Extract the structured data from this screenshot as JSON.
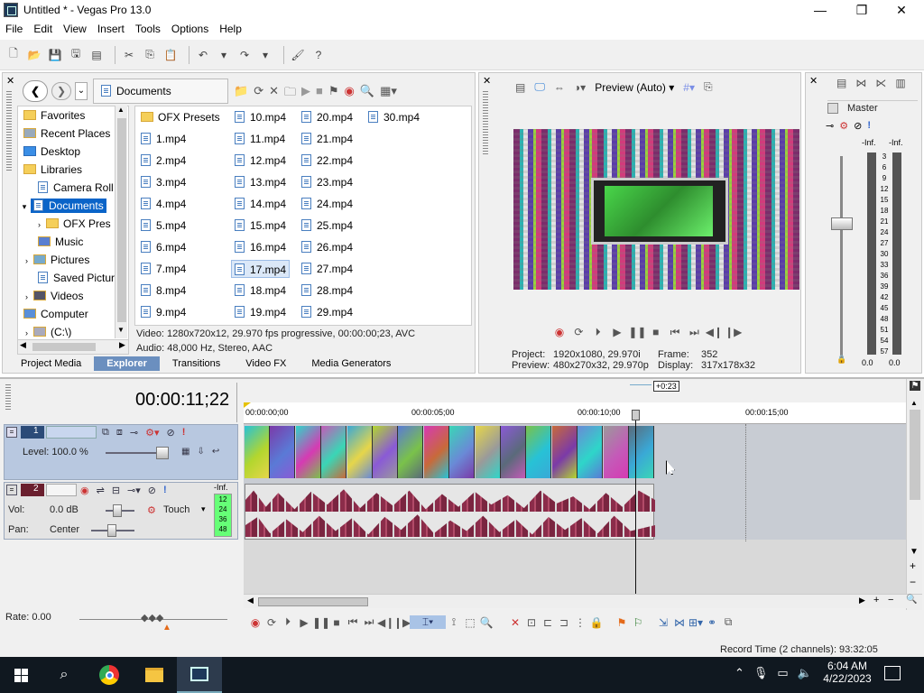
{
  "window": {
    "title": "Untitled * - Vegas Pro 13.0",
    "minimize": "—",
    "maximize": "❐",
    "close": "✕"
  },
  "menu": [
    "File",
    "Edit",
    "View",
    "Insert",
    "Tools",
    "Options",
    "Help"
  ],
  "explorer": {
    "location": "Documents",
    "tree": [
      "Favorites",
      "Recent Places",
      "Desktop",
      "Libraries",
      "Camera Roll",
      "Documents",
      "OFX Pres",
      "Music",
      "Pictures",
      "Saved Pictur",
      "Videos",
      "Computer",
      "(C:\\)"
    ],
    "files_col1": [
      "OFX Presets",
      "1.mp4",
      "2.mp4",
      "3.mp4",
      "4.mp4",
      "5.mp4",
      "6.mp4",
      "7.mp4",
      "8.mp4",
      "9.mp4"
    ],
    "files_col2": [
      "10.mp4",
      "11.mp4",
      "12.mp4",
      "13.mp4",
      "14.mp4",
      "15.mp4",
      "16.mp4",
      "17.mp4",
      "18.mp4",
      "19.mp4"
    ],
    "files_col3": [
      "20.mp4",
      "21.mp4",
      "22.mp4",
      "23.mp4",
      "24.mp4",
      "25.mp4",
      "26.mp4",
      "27.mp4",
      "28.mp4",
      "29.mp4"
    ],
    "files_col4": [
      "30.mp4"
    ],
    "selected": "17.mp4",
    "info_video": "Video: 1280x720x12, 29.970 fps progressive, 00:00:00;23, AVC",
    "info_audio": "Audio: 48,000 Hz, Stereo, AAC",
    "tabs": [
      "Project Media",
      "Explorer",
      "Transitions",
      "Video FX",
      "Media Generators"
    ]
  },
  "preview": {
    "mode": "Preview (Auto)",
    "project_label": "Project:",
    "project_val": "1920x1080, 29.970i",
    "preview_label": "Preview:",
    "preview_val": "480x270x32, 29.970p",
    "frame_label": "Frame:",
    "frame_val": "352",
    "display_label": "Display:",
    "display_val": "317x178x32"
  },
  "master": {
    "title": "Master",
    "inf_l": "-Inf.",
    "inf_r": "-Inf.",
    "scale": [
      "3",
      "6",
      "9",
      "12",
      "15",
      "18",
      "21",
      "24",
      "27",
      "30",
      "33",
      "36",
      "39",
      "42",
      "45",
      "48",
      "51",
      "54",
      "57"
    ],
    "val_l": "0.0",
    "val_r": "0.0"
  },
  "timeline": {
    "timecode": "00:00:11;22",
    "marker_offset": "+0:23",
    "ruler": [
      "00:00:00;00",
      "00:00:05;00",
      "00:00:10;00",
      "00:00:15;00"
    ],
    "video_track": {
      "num": "1",
      "level": "Level: 100.0 %"
    },
    "audio_track": {
      "num": "2",
      "vol_label": "Vol:",
      "vol": "0.0 dB",
      "pan_label": "Pan:",
      "pan": "Center",
      "mode": "Touch",
      "inf": "-Inf.",
      "meter": [
        "12",
        "24",
        "36",
        "48"
      ]
    },
    "rate": "Rate: 0.00",
    "record_time": "Record Time (2 channels): 93:32:05"
  },
  "taskbar": {
    "time": "6:04 AM",
    "date": "4/22/2023"
  }
}
